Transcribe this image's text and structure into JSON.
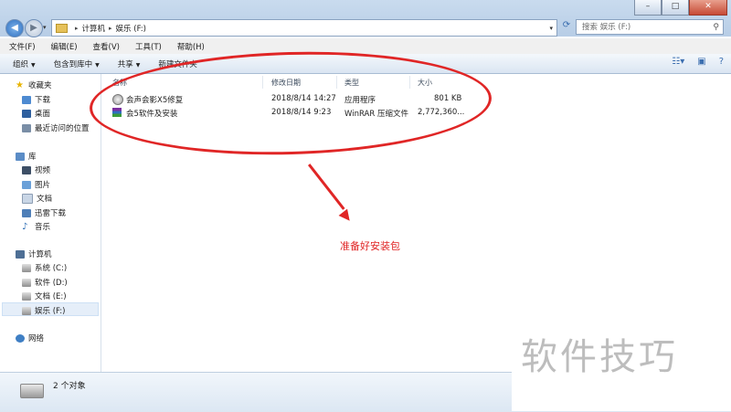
{
  "window": {
    "minimize": "–",
    "maximize": "□",
    "close": "✕"
  },
  "address": {
    "parts": [
      "计算机",
      "娱乐 (F:)"
    ],
    "search_placeholder": "搜索 娱乐 (F:)"
  },
  "menu": [
    "文件(F)",
    "编辑(E)",
    "查看(V)",
    "工具(T)",
    "帮助(H)"
  ],
  "toolbar": {
    "organize": "组织",
    "include_library": "包含到库中",
    "share": "共享",
    "new_folder": "新建文件夹"
  },
  "sidebar": {
    "favorites": "收藏夹",
    "downloads": "下载",
    "desktop": "桌面",
    "recent": "最近访问的位置",
    "libraries": "库",
    "videos": "视频",
    "pictures": "图片",
    "documents": "文档",
    "xunlei": "迅雷下载",
    "music": "音乐",
    "computer": "计算机",
    "drive_c": "系统 (C:)",
    "drive_d": "软件 (D:)",
    "drive_e": "文档 (E:)",
    "drive_f": "娱乐 (F:)",
    "network": "网络"
  },
  "columns": {
    "name": "名称",
    "modified": "修改日期",
    "type": "类型",
    "size": "大小"
  },
  "files": [
    {
      "name": "会声会影X5修复",
      "modified": "2018/8/14 14:27",
      "type": "应用程序",
      "size": "801 KB"
    },
    {
      "name": "会5软件及安装",
      "modified": "2018/8/14 9:23",
      "type": "WinRAR 压缩文件",
      "size": "2,772,360..."
    }
  ],
  "annotation": "准备好安装包",
  "status": {
    "count": "2 个对象"
  },
  "watermark": "软件技巧",
  "colors": {
    "annotation_red": "#e02626",
    "title_blue": "#b7cde6"
  }
}
